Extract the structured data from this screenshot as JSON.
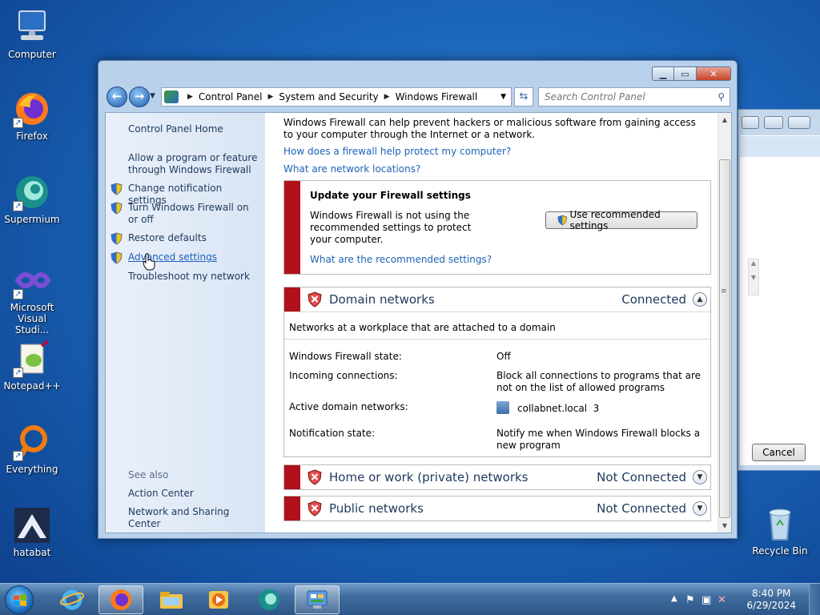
{
  "desktop": {
    "icons": [
      {
        "label": "Computer",
        "icon": "computer-icon"
      },
      {
        "label": "Firefox",
        "icon": "firefox-icon"
      },
      {
        "label": "Supermium",
        "icon": "supermium-icon"
      },
      {
        "label": "Microsoft Visual Studi...",
        "icon": "visual-studio-icon"
      },
      {
        "label": "Notepad++",
        "icon": "notepadpp-icon"
      },
      {
        "label": "Everything",
        "icon": "everything-icon"
      },
      {
        "label": "hatabat",
        "icon": "hatabat-icon"
      }
    ],
    "recycle_bin": "Recycle Bin"
  },
  "back_window": {
    "cancel_label": "Cancel"
  },
  "window": {
    "address": {
      "crumbs": [
        "Control Panel",
        "System and Security",
        "Windows Firewall"
      ]
    },
    "search": {
      "placeholder": "Search Control Panel"
    },
    "left_pane": {
      "home": "Control Panel Home",
      "tasks": [
        {
          "label": "Allow a program or feature through Windows Firewall",
          "shield": false
        },
        {
          "label": "Change notification settings",
          "shield": true
        },
        {
          "label": "Turn Windows Firewall on or off",
          "shield": true
        },
        {
          "label": "Restore defaults",
          "shield": true
        },
        {
          "label": "Advanced settings",
          "shield": true
        },
        {
          "label": "Troubleshoot my network",
          "shield": false
        }
      ],
      "see_also": "See also",
      "see_also_links": [
        "Action Center",
        "Network and Sharing Center"
      ]
    },
    "content": {
      "intro": "Windows Firewall can help prevent hackers or malicious software from gaining access to your computer through the Internet or a network.",
      "link1": "How does a firewall help protect my computer?",
      "link2": "What are network locations?",
      "update": {
        "title": "Update your Firewall settings",
        "text": "Windows Firewall is not using the recommended settings to protect your computer.",
        "link": "What are the recommended settings?",
        "button": "Use recommended settings"
      },
      "domain": {
        "title": "Domain networks",
        "status": "Connected",
        "description": "Networks at a workplace that are attached to a domain",
        "rows": [
          {
            "key": "Windows Firewall state:",
            "value": "Off"
          },
          {
            "key": "Incoming connections:",
            "value": "Block all connections to programs that are not on the list of allowed programs"
          },
          {
            "key": "Active domain networks:",
            "value": "collabnet.local  3"
          },
          {
            "key": "Notification state:",
            "value": "Notify me when Windows Firewall blocks a new program"
          }
        ]
      },
      "home": {
        "title": "Home or work (private) networks",
        "status": "Not Connected"
      },
      "public": {
        "title": "Public networks",
        "status": "Not Connected"
      }
    }
  },
  "taskbar": {
    "items": [
      "internet-explorer-icon",
      "firefox-icon",
      "file-explorer-icon",
      "media-player-icon",
      "supermium-icon",
      "control-panel-icon"
    ],
    "clock": {
      "time": "8:40 PM",
      "date": "6/29/2024"
    }
  },
  "colors": {
    "accent_red": "#b0101a",
    "link_blue": "#1d63b8",
    "nav_text": "#1e395b"
  }
}
